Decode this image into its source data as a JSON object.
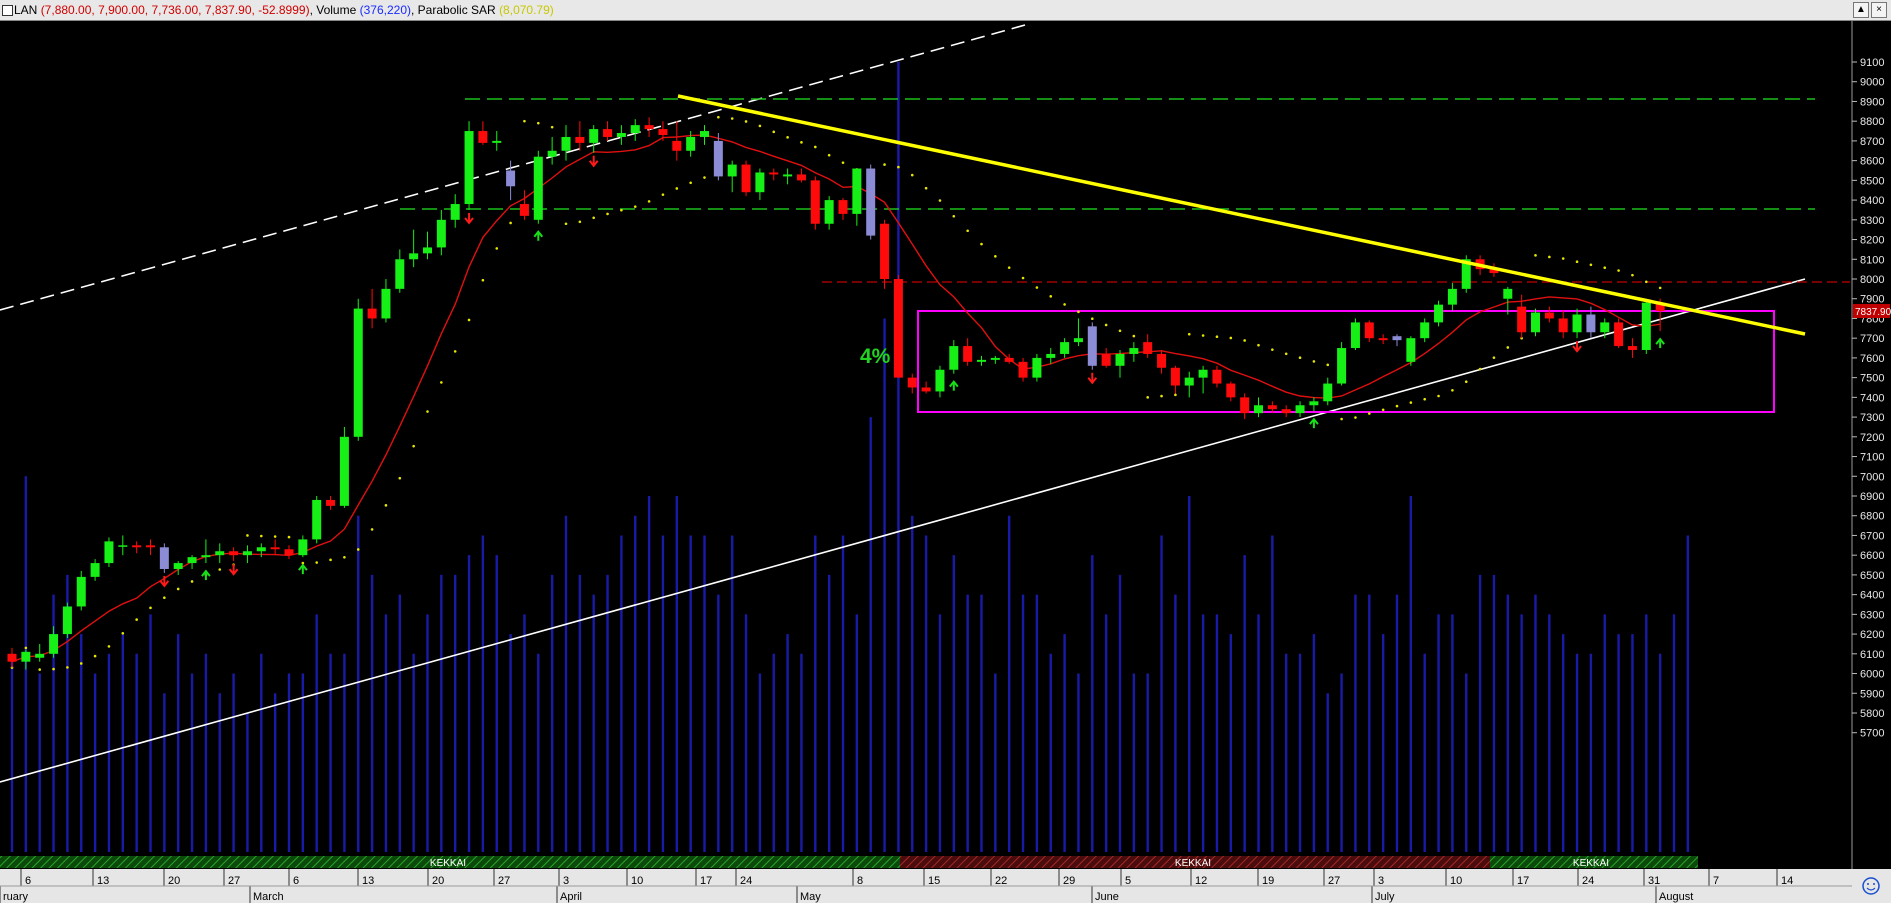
{
  "header": {
    "symbol": "LAN",
    "ohlc": "(7,880.00, 7,900.00, 7,736.00, 7,837.90, -52.8999)",
    "volume_label": "Volume",
    "volume_value": "(376,220)",
    "sar_label": "Parabolic SAR",
    "sar_value": "(8,070.79)",
    "btn_up": "▲",
    "btn_x": "×"
  },
  "chart_data": {
    "type": "candlestick",
    "ylim": [
      5620,
      9180
    ],
    "y_ticks": [
      5700,
      5800,
      5900,
      6000,
      6100,
      6200,
      6300,
      6400,
      6500,
      6600,
      6700,
      6800,
      6900,
      7000,
      7100,
      7200,
      7300,
      7400,
      7500,
      7600,
      7700,
      7800,
      7900,
      8000,
      8100,
      8200,
      8300,
      8400,
      8500,
      8600,
      8700,
      8800,
      8900,
      9000,
      9100
    ],
    "last_price_label": "7837.90",
    "annotation_text": "4%",
    "cloud_labels": [
      "KEKKAI",
      "KEKKAI",
      "KEKKAI"
    ],
    "x_day_labels": [
      "6",
      "13",
      "20",
      "27",
      "6",
      "13",
      "20",
      "27",
      "3",
      "10",
      "17",
      "24",
      "8",
      "15",
      "22",
      "29",
      "5",
      "12",
      "19",
      "27",
      "3",
      "10",
      "17",
      "24",
      "31",
      "7",
      "14"
    ],
    "x_month_labels": [
      "ruary",
      "March",
      "April",
      "May",
      "June",
      "July",
      "August"
    ],
    "candles": [
      [
        6100,
        6130,
        6030,
        6060
      ],
      [
        6060,
        6120,
        6020,
        6110
      ],
      [
        6080,
        6150,
        6060,
        6100
      ],
      [
        6100,
        6240,
        6080,
        6200
      ],
      [
        6200,
        6360,
        6180,
        6340
      ],
      [
        6340,
        6520,
        6320,
        6490
      ],
      [
        6490,
        6580,
        6470,
        6560
      ],
      [
        6560,
        6690,
        6540,
        6670
      ],
      [
        6650,
        6700,
        6600,
        6650
      ],
      [
        6650,
        6670,
        6610,
        6640
      ],
      [
        6650,
        6680,
        6600,
        6640
      ],
      [
        6640,
        6660,
        6510,
        6530
      ],
      [
        6530,
        6570,
        6500,
        6560
      ],
      [
        6560,
        6600,
        6530,
        6590
      ],
      [
        6590,
        6680,
        6560,
        6600
      ],
      [
        6600,
        6660,
        6560,
        6620
      ],
      [
        6620,
        6640,
        6570,
        6600
      ],
      [
        6600,
        6650,
        6560,
        6620
      ],
      [
        6620,
        6660,
        6590,
        6640
      ],
      [
        6640,
        6680,
        6600,
        6630
      ],
      [
        6630,
        6650,
        6580,
        6600
      ],
      [
        6600,
        6700,
        6590,
        6680
      ],
      [
        6680,
        6900,
        6660,
        6880
      ],
      [
        6880,
        6900,
        6830,
        6850
      ],
      [
        6850,
        7250,
        6840,
        7200
      ],
      [
        7200,
        7900,
        7180,
        7850
      ],
      [
        7850,
        7950,
        7750,
        7800
      ],
      [
        7800,
        8000,
        7780,
        7950
      ],
      [
        7950,
        8150,
        7930,
        8100
      ],
      [
        8100,
        8250,
        8060,
        8130
      ],
      [
        8130,
        8240,
        8100,
        8160
      ],
      [
        8160,
        8350,
        8120,
        8300
      ],
      [
        8300,
        8430,
        8260,
        8380
      ],
      [
        8380,
        8800,
        8350,
        8750
      ],
      [
        8750,
        8800,
        8680,
        8690
      ],
      [
        8690,
        8750,
        8650,
        8700
      ],
      [
        8470,
        8600,
        8400,
        8550
      ],
      [
        8380,
        8450,
        8300,
        8320
      ],
      [
        8300,
        8650,
        8280,
        8620
      ],
      [
        8620,
        8720,
        8580,
        8650
      ],
      [
        8650,
        8780,
        8600,
        8720
      ],
      [
        8720,
        8800,
        8650,
        8690
      ],
      [
        8690,
        8780,
        8640,
        8760
      ],
      [
        8760,
        8800,
        8700,
        8720
      ],
      [
        8720,
        8780,
        8680,
        8740
      ],
      [
        8740,
        8810,
        8700,
        8780
      ],
      [
        8780,
        8820,
        8720,
        8760
      ],
      [
        8760,
        8800,
        8700,
        8730
      ],
      [
        8700,
        8800,
        8600,
        8650
      ],
      [
        8650,
        8750,
        8620,
        8720
      ],
      [
        8720,
        8780,
        8680,
        8750
      ],
      [
        8700,
        8740,
        8500,
        8520
      ],
      [
        8520,
        8600,
        8440,
        8580
      ],
      [
        8580,
        8600,
        8420,
        8440
      ],
      [
        8440,
        8560,
        8400,
        8540
      ],
      [
        8540,
        8560,
        8500,
        8530
      ],
      [
        8520,
        8560,
        8480,
        8530
      ],
      [
        8530,
        8560,
        8490,
        8500
      ],
      [
        8500,
        8520,
        8250,
        8280
      ],
      [
        8280,
        8420,
        8250,
        8400
      ],
      [
        8400,
        8410,
        8300,
        8330
      ],
      [
        8330,
        8500,
        8270,
        8560
      ],
      [
        8560,
        8580,
        8200,
        8220
      ],
      [
        8280,
        8300,
        7950,
        8000
      ],
      [
        8000,
        8020,
        7550,
        7500
      ],
      [
        7500,
        7520,
        7420,
        7450
      ],
      [
        7450,
        7480,
        7420,
        7430
      ],
      [
        7430,
        7560,
        7400,
        7540
      ],
      [
        7540,
        7690,
        7520,
        7660
      ],
      [
        7660,
        7700,
        7560,
        7580
      ],
      [
        7580,
        7610,
        7560,
        7590
      ],
      [
        7590,
        7610,
        7570,
        7600
      ],
      [
        7600,
        7620,
        7570,
        7580
      ],
      [
        7580,
        7600,
        7480,
        7500
      ],
      [
        7500,
        7620,
        7480,
        7600
      ],
      [
        7600,
        7650,
        7570,
        7620
      ],
      [
        7620,
        7700,
        7600,
        7680
      ],
      [
        7680,
        7800,
        7660,
        7700
      ],
      [
        7560,
        7780,
        7540,
        7760
      ],
      [
        7620,
        7650,
        7550,
        7560
      ],
      [
        7560,
        7640,
        7500,
        7620
      ],
      [
        7620,
        7680,
        7580,
        7650
      ],
      [
        7680,
        7720,
        7600,
        7620
      ],
      [
        7620,
        7640,
        7520,
        7550
      ],
      [
        7550,
        7560,
        7420,
        7460
      ],
      [
        7460,
        7530,
        7400,
        7500
      ],
      [
        7500,
        7560,
        7420,
        7540
      ],
      [
        7540,
        7560,
        7450,
        7470
      ],
      [
        7470,
        7480,
        7380,
        7400
      ],
      [
        7400,
        7420,
        7290,
        7320
      ],
      [
        7320,
        7400,
        7300,
        7360
      ],
      [
        7360,
        7380,
        7320,
        7340
      ],
      [
        7340,
        7360,
        7300,
        7320
      ],
      [
        7320,
        7380,
        7300,
        7360
      ],
      [
        7360,
        7400,
        7330,
        7380
      ],
      [
        7380,
        7500,
        7360,
        7470
      ],
      [
        7470,
        7680,
        7460,
        7650
      ],
      [
        7650,
        7800,
        7640,
        7780
      ],
      [
        7780,
        7790,
        7680,
        7700
      ],
      [
        7700,
        7720,
        7670,
        7690
      ],
      [
        7690,
        7720,
        7660,
        7710
      ],
      [
        7580,
        7710,
        7560,
        7700
      ],
      [
        7700,
        7800,
        7680,
        7780
      ],
      [
        7780,
        7890,
        7760,
        7870
      ],
      [
        7870,
        7980,
        7840,
        7950
      ],
      [
        7950,
        8120,
        7930,
        8100
      ],
      [
        8100,
        8120,
        8020,
        8050
      ],
      [
        8050,
        8080,
        8010,
        8030
      ],
      [
        7900,
        7960,
        7820,
        7950
      ],
      [
        7860,
        7920,
        7700,
        7730
      ],
      [
        7730,
        7850,
        7710,
        7830
      ],
      [
        7830,
        7860,
        7780,
        7800
      ],
      [
        7800,
        7840,
        7700,
        7730
      ],
      [
        7730,
        7850,
        7700,
        7820
      ],
      [
        7820,
        7860,
        7700,
        7730
      ],
      [
        7730,
        7800,
        7700,
        7780
      ],
      [
        7780,
        7800,
        7650,
        7660
      ],
      [
        7660,
        7700,
        7600,
        7640
      ],
      [
        7640,
        7900,
        7620,
        7880
      ],
      [
        7880,
        7900,
        7736,
        7837.9
      ]
    ],
    "volume": [
      6100,
      7000,
      6000,
      6400,
      6500,
      6200,
      6000,
      6100,
      6200,
      6100,
      6300,
      5900,
      6200,
      6000,
      6100,
      5900,
      6000,
      5800,
      6100,
      5900,
      6000,
      6000,
      6300,
      6100,
      6100,
      6800,
      6500,
      6300,
      6400,
      6100,
      6300,
      6500,
      6500,
      6600,
      6700,
      6600,
      6200,
      6300,
      6100,
      6500,
      6800,
      6500,
      6400,
      6500,
      6700,
      6800,
      6900,
      6700,
      6900,
      6700,
      6700,
      6400,
      6700,
      6300,
      6000,
      6100,
      6200,
      6100,
      6700,
      6500,
      6700,
      6300,
      7300,
      7800,
      9100,
      6800,
      6700,
      6300,
      6600,
      6400,
      6400,
      6000,
      6800,
      6400,
      6400,
      6100,
      6200,
      6000,
      6600,
      6300,
      6500,
      6000,
      6000,
      6700,
      6400,
      6900,
      6300,
      6300,
      6200,
      6600,
      6300,
      6700,
      6100,
      6100,
      6200,
      5900,
      6000,
      6400,
      6400,
      6200,
      6400,
      6900,
      6100,
      6300,
      6300,
      6000,
      6500,
      6500,
      6400,
      6300,
      6400,
      6300,
      6200,
      6100,
      6100,
      6300,
      6200,
      6200,
      6300,
      6100,
      6300,
      6700
    ]
  }
}
